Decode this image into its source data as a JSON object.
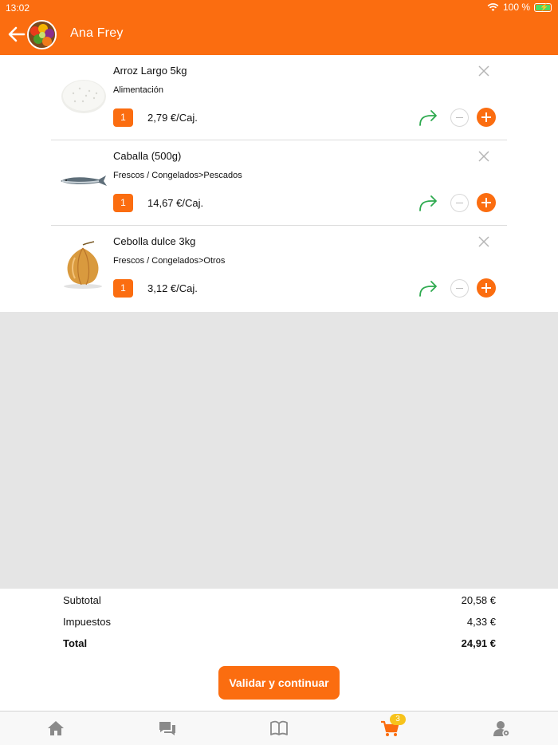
{
  "status_bar": {
    "time": "13:02",
    "battery": "100 %"
  },
  "header": {
    "title": "Ana Frey"
  },
  "items": [
    {
      "name": "Arroz Largo 5kg",
      "category": "Alimentación",
      "quantity": "1",
      "price": "2,79 €/Caj."
    },
    {
      "name": "Caballa (500g)",
      "category": "Frescos / Congelados>Pescados",
      "quantity": "1",
      "price": "14,67 €/Caj."
    },
    {
      "name": "Cebolla dulce 3kg",
      "category": "Frescos / Congelados>Otros",
      "quantity": "1",
      "price": "3,12 €/Caj."
    }
  ],
  "totals": {
    "subtotal_label": "Subtotal",
    "subtotal_value": "20,58 €",
    "tax_label": "Impuestos",
    "tax_value": "4,33 €",
    "total_label": "Total",
    "total_value": "24,91 €"
  },
  "validate_label": "Validar y continuar",
  "tabbar": {
    "cart_badge": "3"
  },
  "colors": {
    "accent": "#fb6d10",
    "share": "#2eaa4f",
    "badge": "#f7c31c",
    "tab_icon": "#8a8a8a"
  }
}
